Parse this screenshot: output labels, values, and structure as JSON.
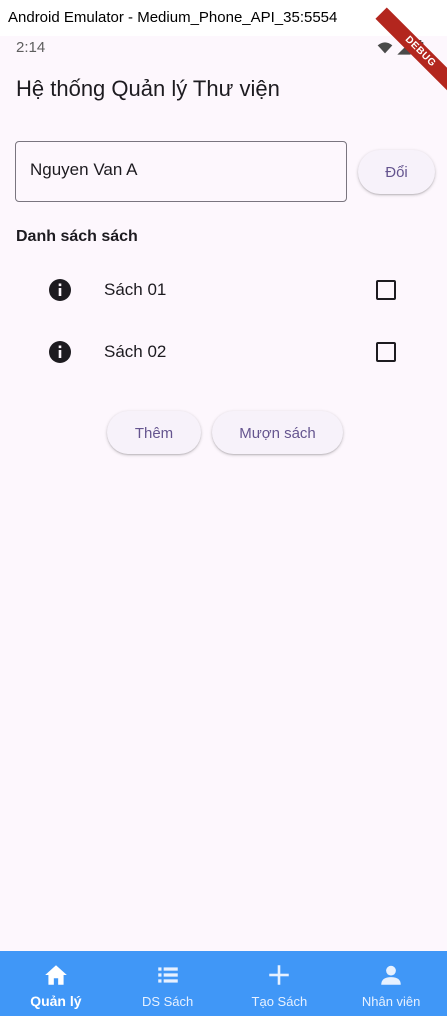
{
  "window": {
    "title": "Android Emulator - Medium_Phone_API_35:5554"
  },
  "status_bar": {
    "time": "2:14"
  },
  "debug_banner": "DEBUG",
  "app": {
    "title": "Hệ thống Quản lý Thư viện"
  },
  "name_input": {
    "value": "Nguyen Van A",
    "button": "Đổi"
  },
  "book_list": {
    "heading": "Danh sách sách",
    "items": [
      {
        "label": "Sách 01",
        "icon": "info-icon",
        "checked": false
      },
      {
        "label": "Sách 02",
        "icon": "info-icon",
        "checked": false
      }
    ]
  },
  "actions": {
    "add": "Thêm",
    "borrow": "Mượn sách"
  },
  "bottom_nav": {
    "items": [
      {
        "label": "Quản lý",
        "icon": "home-icon",
        "active": true
      },
      {
        "label": "DS Sách",
        "icon": "list-icon",
        "active": false
      },
      {
        "label": "Tạo Sách",
        "icon": "add-icon",
        "active": false
      },
      {
        "label": "Nhân viên",
        "icon": "person-icon",
        "active": false
      }
    ]
  },
  "colors": {
    "background": "#fdf7fd",
    "accent": "#65558f",
    "nav": "#4097f7",
    "debug": "#b3261e"
  }
}
